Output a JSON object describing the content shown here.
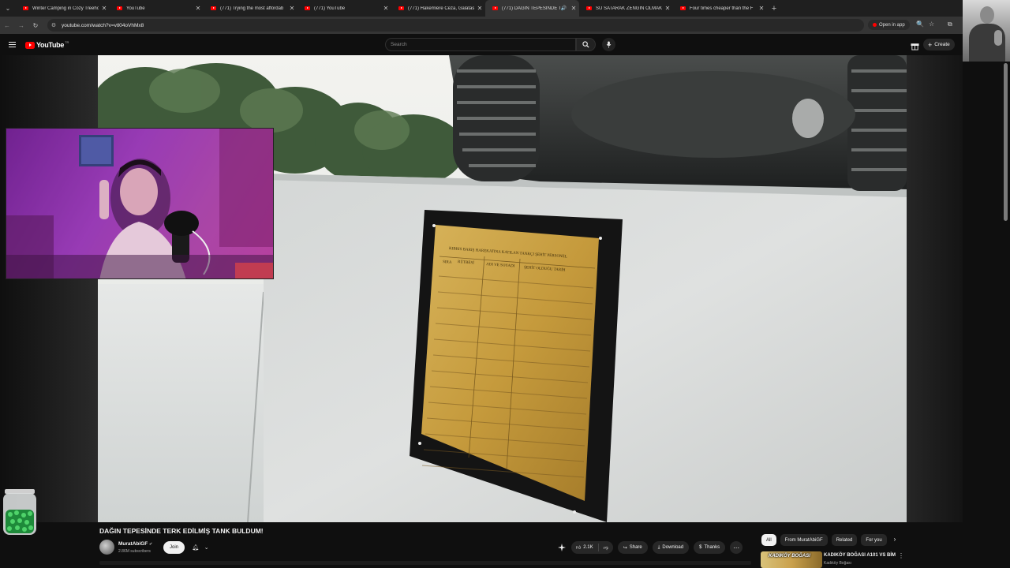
{
  "browser": {
    "tabs": [
      {
        "title": "Winter Camping in Cozy Treeho",
        "active": false
      },
      {
        "title": "YouTube",
        "active": false
      },
      {
        "title": "(771) Trying the most affordab",
        "active": false
      },
      {
        "title": "(771) YouTube",
        "active": false
      },
      {
        "title": "(771) Hakemlere Ceza, Galatasa",
        "active": false
      },
      {
        "title": "(771) DAĞIN TEPESİNDE TE",
        "active": true
      },
      {
        "title": "SU SATARAK ZENGİN OLMAK!",
        "active": false
      },
      {
        "title": "Four times cheaper than the F",
        "active": false
      }
    ],
    "url": "youtube.com/watch?v=vtl04oVhMx8",
    "open_in_app_label": "Open in app"
  },
  "youtube": {
    "logo_text": "YouTube",
    "country_code": "TR",
    "search_placeholder": "Search",
    "create_label": "Create"
  },
  "video": {
    "title": "DAĞIN TEPESİNDE TERK EDİLMİŞ TANK BULDUM!",
    "plaque_heading": "KIBRIS BARIŞ HAREKATINA KATILAN TANKÇI ŞEHİT PERSONEL",
    "plaque_columns": [
      "SIRA",
      "RÜTBESİ",
      "ADI VE SOYADI",
      "ŞEHİT OLDUĞU TARİH"
    ]
  },
  "channel": {
    "name": "MuratAbiGF",
    "subscribers": "2.86M subscribers",
    "join_label": "Join"
  },
  "actions": {
    "likes": "2.1K",
    "share": "Share",
    "download": "Download",
    "thanks": "Thanks"
  },
  "chips": [
    "All",
    "From MuratAbiGF",
    "Related",
    "For you"
  ],
  "recommendation": {
    "thumb_text": "KADIKÖY BOĞASI",
    "title": "KADIKÖY BOĞASI A101 VS BİM",
    "channel": "Kadıköy Boğası"
  }
}
